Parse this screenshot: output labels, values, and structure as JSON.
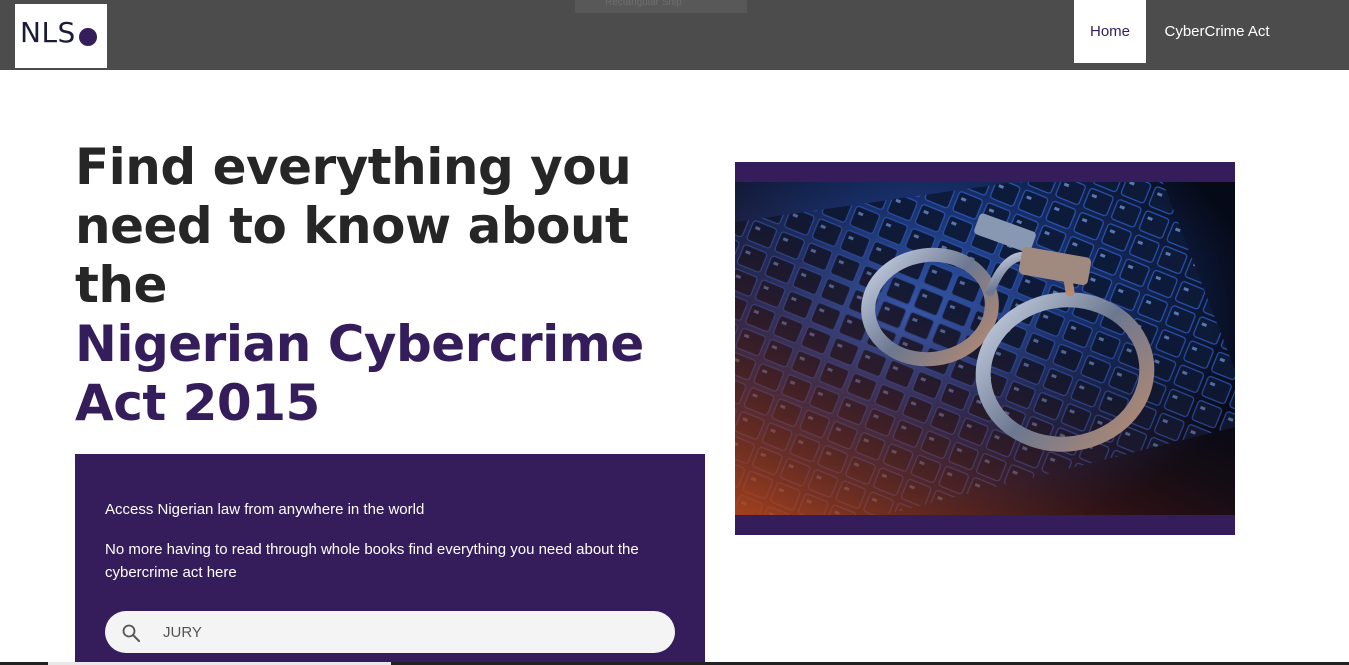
{
  "header": {
    "logo_text": "NLS",
    "ghost_text": "Rectangular Snip",
    "nav": [
      {
        "label": "Home",
        "active": true
      },
      {
        "label": "CyberCrime Act",
        "active": false
      }
    ]
  },
  "hero": {
    "line1": "Find everything you",
    "line2": "need to know about the",
    "accent1": "Nigerian Cybercrime",
    "accent2": "Act 2015"
  },
  "panel": {
    "line1": "Access Nigerian law from anywhere in the world",
    "line2": "No more having to read through whole books find everything you need about the cybercrime act here"
  },
  "search": {
    "value": "JURY",
    "icon": "search-icon"
  },
  "image": {
    "subject": "handcuffs-on-keyboard"
  },
  "colors": {
    "brand": "#341d5a",
    "topbar": "#4c4c4c",
    "heading": "#262626"
  }
}
